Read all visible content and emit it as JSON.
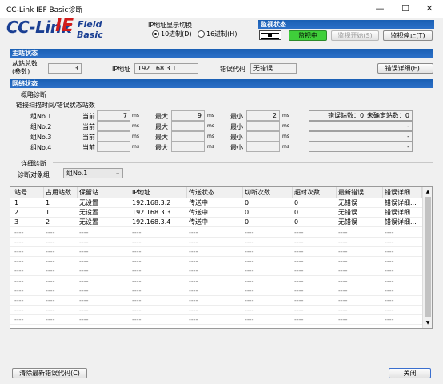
{
  "window": {
    "title": "CC-Link IEF Basic诊断",
    "minimize": "—",
    "maximize": "☐",
    "close": "✕"
  },
  "logo": {
    "cc": "CC-Link",
    "ie": "IE",
    "field": "Field",
    "basic": "Basic"
  },
  "ip_switch": {
    "title": "IP地址显示切换",
    "opt10": "10进制(D)",
    "opt16": "16进制(H)"
  },
  "monitor": {
    "title": "监视状态",
    "status": "监视中",
    "start": "监视开始(S)",
    "stop": "监视停止(T)"
  },
  "master": {
    "title": "主站状态",
    "slave_count_label1": "从站总数",
    "slave_count_label2": "(参数)",
    "slave_count": "3",
    "ip_label": "IP地址",
    "ip": "192.168.3.1",
    "err_label": "错误代码",
    "err": "无错误",
    "err_detail": "错误详细(E)..."
  },
  "network": {
    "title": "网络状态",
    "overview": "概略诊断",
    "scan_title": "链接扫描时间/错误状态站数",
    "col_cur": "当前",
    "col_max": "最大",
    "col_min": "最小",
    "unit": "ms",
    "err_count_label": "错误站数：0",
    "undet_label": "未确定站数：0",
    "groups": [
      {
        "name": "组No.1",
        "cur": "7",
        "max": "9",
        "min": "2",
        "extra": ""
      },
      {
        "name": "组No.2",
        "cur": "",
        "max": "",
        "min": "",
        "extra": "-"
      },
      {
        "name": "组No.3",
        "cur": "",
        "max": "",
        "min": "",
        "extra": "-"
      },
      {
        "name": "组No.4",
        "cur": "",
        "max": "",
        "min": "",
        "extra": "-"
      }
    ]
  },
  "detail": {
    "title": "详细诊断",
    "target_label": "诊断对象组",
    "target": "组No.1",
    "headers": [
      "站号",
      "占用站数",
      "保留站",
      "IP地址",
      "传送状态",
      "切断次数",
      "超时次数",
      "最新错误",
      "错误详细"
    ],
    "rows": [
      [
        "1",
        "1",
        "无设置",
        "192.168.3.2",
        "传送中",
        "0",
        "0",
        "无错误",
        "错误详细..."
      ],
      [
        "2",
        "1",
        "无设置",
        "192.168.3.3",
        "传送中",
        "0",
        "0",
        "无错误",
        "错误详细..."
      ],
      [
        "3",
        "2",
        "无设置",
        "192.168.3.4",
        "传送中",
        "0",
        "0",
        "无错误",
        "错误详细..."
      ]
    ],
    "empty_row": [
      "----",
      "----",
      "----",
      "----",
      "----",
      "----",
      "----",
      "----",
      "----"
    ]
  },
  "footer": {
    "clear": "清除最新错误代码(C)",
    "close": "关闭"
  }
}
